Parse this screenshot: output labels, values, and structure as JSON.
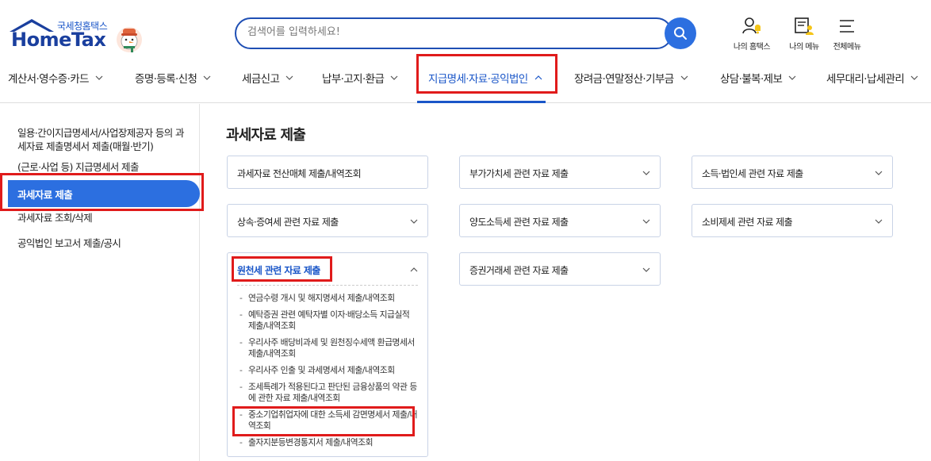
{
  "header": {
    "logo_sub": "국세청홈택스",
    "logo_main": "HomeTax",
    "search_placeholder": "검색어를 입력하세요!",
    "utils": [
      {
        "label": "나의 홈택스",
        "icon": "user-bell-icon"
      },
      {
        "label": "나의 메뉴",
        "icon": "doc-user-icon"
      },
      {
        "label": "전체메뉴",
        "icon": "hamburger-icon"
      }
    ]
  },
  "gnb": {
    "items": [
      {
        "label": "계산서·영수증·카드"
      },
      {
        "label": "증명·등록·신청"
      },
      {
        "label": "세금신고"
      },
      {
        "label": "납부·고지·환급"
      },
      {
        "label": "지급명세·자료·공익법인",
        "active": true
      },
      {
        "label": "장려금·연말정산·기부금"
      },
      {
        "label": "상담·불복·제보"
      },
      {
        "label": "세무대리·납세관리"
      }
    ]
  },
  "sidebar": {
    "items": [
      {
        "label": "일용·간이지급명세서/사업장제공자 등의 과세자료 제출명세서 제출(매월·반기)"
      },
      {
        "label": "(근로·사업 등) 지급명세서 제출"
      },
      {
        "label": "과세자료 제출",
        "active": true
      },
      {
        "label": "과세자료 조회/삭제"
      },
      {
        "label": "공익법인 보고서 제출/공시"
      }
    ]
  },
  "main": {
    "title": "과세자료 제출",
    "cards": [
      {
        "label": "과세자료 전산매체 제출/내역조회"
      },
      {
        "label": "부가가치세 관련 자료 제출"
      },
      {
        "label": "소득·법인세 관련 자료 제출"
      },
      {
        "label": "상속·증여세 관련 자료 제출"
      },
      {
        "label": "양도소득세 관련 자료 제출"
      },
      {
        "label": "소비제세 관련 자료 제출"
      },
      {
        "label": "원천세 관련 자료 제출",
        "expanded": true
      },
      {
        "label": "증권거래세 관련 자료 제출"
      }
    ],
    "sub_items": [
      {
        "label": "연금수령 개시 및 해지명세서 제출/내역조회"
      },
      {
        "label": "예탁증권 관련 예탁자별 이자·배당소득 지급실적 제출/내역조회"
      },
      {
        "label": "우리사주 배당비과세 및 원천징수세액 환급명세서 제출/내역조회"
      },
      {
        "label": "우리사주 인출 및 과세명세서 제출/내역조회"
      },
      {
        "label": "조세특례가 적용된다고 판단된 금융상품의 약관 등에 관한 자료 제출/내역조회"
      },
      {
        "label": "중소기업취업자에 대한 소득세 감면명세서 제출/내역조회"
      },
      {
        "label": "출자지분등변경통지서 제출/내역조회"
      }
    ]
  },
  "colors": {
    "brand_blue": "#1a56c8",
    "active_bg": "#2c6fe0",
    "highlight_red": "#e01b1b"
  }
}
